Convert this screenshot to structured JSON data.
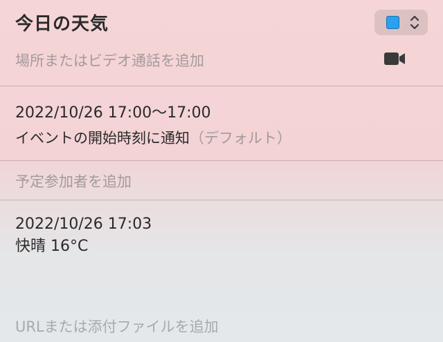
{
  "event": {
    "title": "今日の天気",
    "location_placeholder": "場所またはビデオ通話を追加",
    "datetime": "2022/10/26 17:00～17:00",
    "alert": {
      "label": "イベントの開始時刻に通知",
      "suffix": "（デフォルト）"
    },
    "invitees_placeholder": "予定参加者を追加",
    "notes": {
      "line1": "2022/10/26 17:03",
      "line2": "快晴 16°C"
    },
    "url_placeholder": "URLまたは添付ファイルを追加"
  },
  "colors": {
    "calendar_color": "#2aa0ee"
  },
  "icons": {
    "calendar_picker": "updown-chevron-icon",
    "video": "video-camera-icon"
  }
}
